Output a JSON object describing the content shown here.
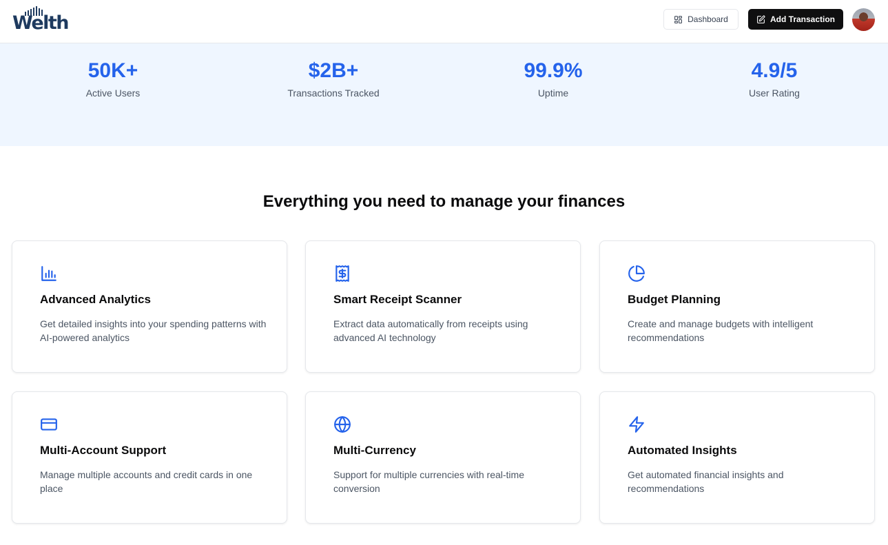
{
  "header": {
    "logo_text": "Welth",
    "dashboard_label": "Dashboard",
    "add_transaction_label": "Add Transaction"
  },
  "stats": [
    {
      "value": "50K+",
      "label": "Active Users"
    },
    {
      "value": "$2B+",
      "label": "Transactions Tracked"
    },
    {
      "value": "99.9%",
      "label": "Uptime"
    },
    {
      "value": "4.9/5",
      "label": "User Rating"
    }
  ],
  "features": {
    "title": "Everything you need to manage your finances",
    "items": [
      {
        "icon": "bar-chart-icon",
        "title": "Advanced Analytics",
        "desc": "Get detailed insights into your spending patterns with AI-powered analytics"
      },
      {
        "icon": "receipt-icon",
        "title": "Smart Receipt Scanner",
        "desc": "Extract data automatically from receipts using advanced AI technology"
      },
      {
        "icon": "pie-chart-icon",
        "title": "Budget Planning",
        "desc": "Create and manage budgets with intelligent recommendations"
      },
      {
        "icon": "credit-card-icon",
        "title": "Multi-Account Support",
        "desc": "Manage multiple accounts and credit cards in one place"
      },
      {
        "icon": "globe-icon",
        "title": "Multi-Currency",
        "desc": "Support for multiple currencies with real-time conversion"
      },
      {
        "icon": "zap-icon",
        "title": "Automated Insights",
        "desc": "Get automated financial insights and recommendations"
      }
    ]
  },
  "colors": {
    "accent": "#2563eb",
    "stats_background": "#eff6ff",
    "primary_button": "#0f0f10",
    "logo": "#1e3a5f"
  }
}
